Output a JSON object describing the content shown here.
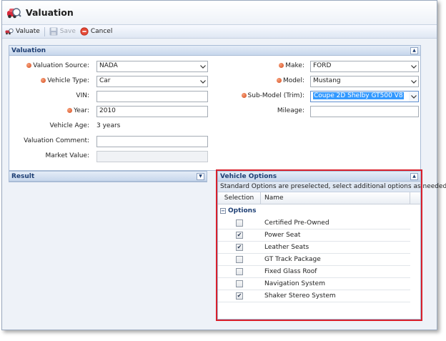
{
  "window": {
    "title": "Valuation"
  },
  "toolbar": {
    "valuate_label": "Valuate",
    "save_label": "Save",
    "cancel_label": "Cancel"
  },
  "valuation_panel": {
    "title": "Valuation",
    "valuation_source": {
      "label": "Valuation Source:",
      "value": "NADA",
      "required": true
    },
    "vehicle_type": {
      "label": "Vehicle Type:",
      "value": "Car",
      "required": true
    },
    "vin": {
      "label": "VIN:",
      "value": ""
    },
    "year": {
      "label": "Year:",
      "value": "2010",
      "required": true
    },
    "vehicle_age": {
      "label": "Vehicle Age:",
      "value": "3 years"
    },
    "valuation_comment": {
      "label": "Valuation Comment:",
      "value": ""
    },
    "market_value": {
      "label": "Market Value:",
      "value": ""
    },
    "make": {
      "label": "Make:",
      "value": "FORD",
      "required": true
    },
    "model": {
      "label": "Model:",
      "value": "Mustang",
      "required": true
    },
    "sub_model": {
      "label": "Sub-Model (Trim):",
      "value": "Coupe 2D Shelby GT500 V8",
      "required": true
    },
    "mileage": {
      "label": "Mileage:",
      "value": ""
    }
  },
  "result_panel": {
    "title": "Result"
  },
  "vehicle_options": {
    "title": "Vehicle Options",
    "instructions": "Standard Options are preselected, select additional options as needed.",
    "columns": {
      "selection": "Selection",
      "name": "Name"
    },
    "group_label": "Options",
    "items": [
      {
        "name": "Certified Pre-Owned",
        "checked": false
      },
      {
        "name": "Power Seat",
        "checked": true
      },
      {
        "name": "Leather Seats",
        "checked": true
      },
      {
        "name": "GT Track Package",
        "checked": false
      },
      {
        "name": "Fixed Glass Roof",
        "checked": false
      },
      {
        "name": "Navigation System",
        "checked": false
      },
      {
        "name": "Shaker Stereo System",
        "checked": true
      }
    ]
  },
  "colors": {
    "panel_header_text": "#1e3f74",
    "required_dot": "#d44b1e",
    "highlight_outline": "#d9202c",
    "selected_text_bg": "#3399ff"
  },
  "icons": {
    "app": "car-valuation-icon",
    "valuate": "valuate-icon",
    "save": "floppy-disk-icon",
    "cancel": "cancel-circle-icon"
  }
}
